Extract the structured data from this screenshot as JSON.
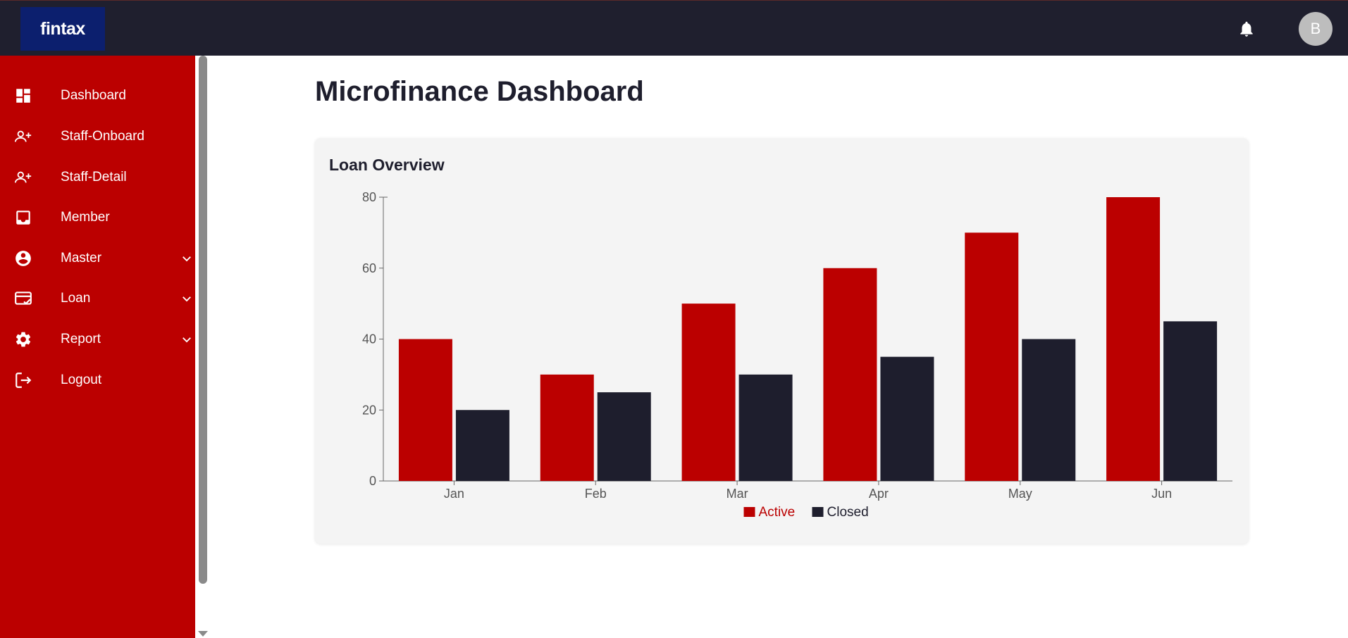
{
  "brand": {
    "logo_text": "fintax",
    "logo_bg": "#0c1f6e"
  },
  "header": {
    "avatar_initial": "B",
    "bell_icon": "bell-icon",
    "bg": "#1f1f2e"
  },
  "sidebar": {
    "bg": "#bb0000",
    "items": [
      {
        "label": "Dashboard",
        "icon": "dashboard-icon",
        "expandable": false
      },
      {
        "label": "Staff-Onboard",
        "icon": "person-add-icon",
        "expandable": false
      },
      {
        "label": "Staff-Detail",
        "icon": "person-add-icon",
        "expandable": false
      },
      {
        "label": "Member",
        "icon": "inbox-icon",
        "expandable": false
      },
      {
        "label": "Master",
        "icon": "account-circle-icon",
        "expandable": true
      },
      {
        "label": "Loan",
        "icon": "credit-card-check-icon",
        "expandable": true
      },
      {
        "label": "Report",
        "icon": "gear-icon",
        "expandable": true
      },
      {
        "label": "Logout",
        "icon": "logout-icon",
        "expandable": false
      }
    ]
  },
  "main": {
    "title": "Microfinance Dashboard",
    "card_title": "Loan Overview"
  },
  "chart_data": {
    "type": "bar",
    "title": "Loan Overview",
    "categories": [
      "Jan",
      "Feb",
      "Mar",
      "Apr",
      "May",
      "Jun"
    ],
    "series": [
      {
        "name": "Active",
        "values": [
          40,
          30,
          50,
          60,
          70,
          80
        ],
        "color": "#bb0000"
      },
      {
        "name": "Closed",
        "values": [
          20,
          25,
          30,
          35,
          40,
          45
        ],
        "color": "#1e1e2d"
      }
    ],
    "ylim": [
      0,
      80
    ],
    "yticks": [
      0,
      20,
      40,
      60,
      80
    ],
    "grid": false,
    "legend_position": "bottom-center"
  }
}
